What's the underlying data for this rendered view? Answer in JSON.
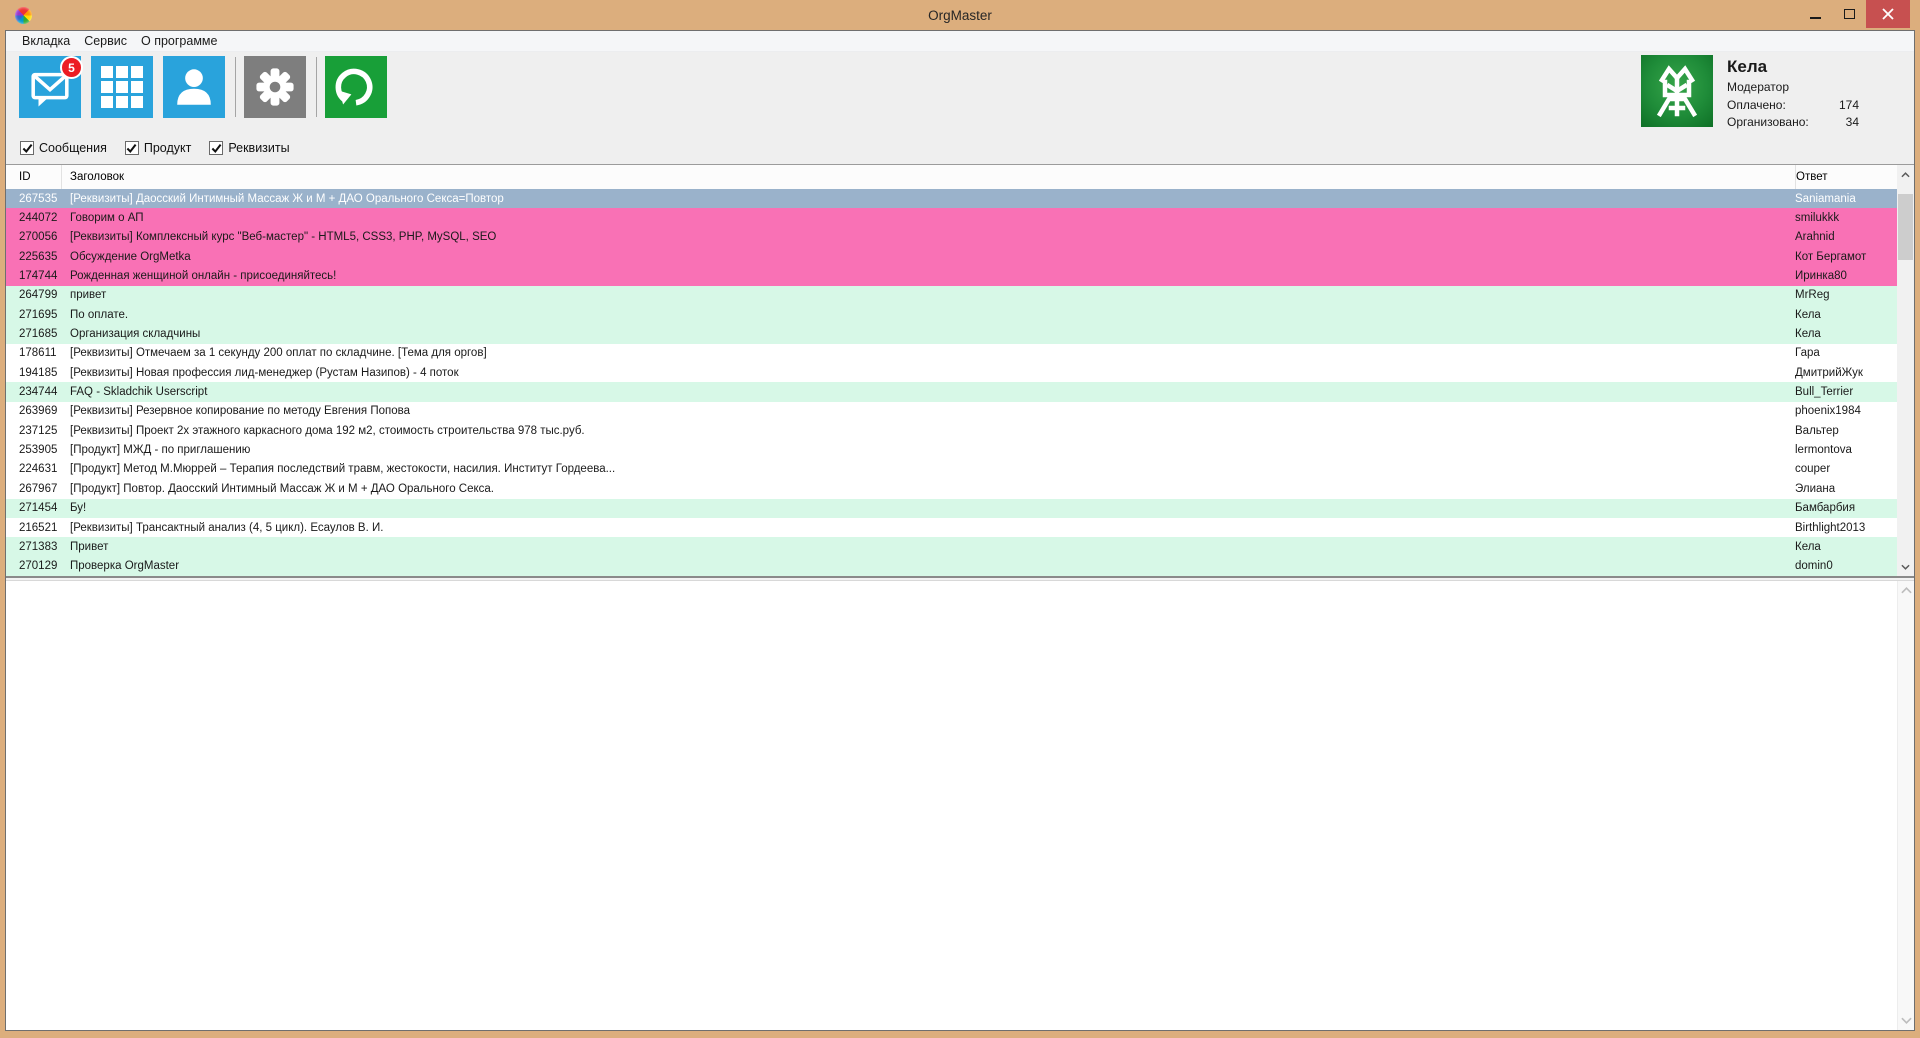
{
  "window": {
    "title": "OrgMaster"
  },
  "menu": {
    "items": [
      "Вкладка",
      "Сервис",
      "О программе"
    ]
  },
  "toolbar": {
    "badge": "5",
    "icons": [
      "mail-icon",
      "grid-icon",
      "user-icon",
      "gear-icon",
      "refresh-icon"
    ]
  },
  "user_panel": {
    "name": "Кела",
    "role": "Модератор",
    "paid_label": "Оплачено:",
    "paid_value": "174",
    "organized_label": "Организовано:",
    "organized_value": "34"
  },
  "filters": [
    {
      "label": "Сообщения",
      "checked": true
    },
    {
      "label": "Продукт",
      "checked": true
    },
    {
      "label": "Реквизиты",
      "checked": true
    }
  ],
  "table": {
    "columns": [
      "ID",
      "Заголовок",
      "Ответ"
    ],
    "rows": [
      {
        "id": "267535",
        "title": "[Реквизиты] Даосский Интимный Массаж Ж и М + ДАО Орального Секса=Повтор",
        "answer": "Saniamania",
        "state": "selected"
      },
      {
        "id": "244072",
        "title": "Говорим о АП",
        "answer": "smilukkk",
        "state": "pink"
      },
      {
        "id": "270056",
        "title": "[Реквизиты] Комплексный курс \"Веб-мастер\" - HTML5, CSS3, PHP, MySQL, SEO",
        "answer": "Arahnid",
        "state": "pink"
      },
      {
        "id": "225635",
        "title": "Обсуждение OrgMetka",
        "answer": "Кот Бергамот",
        "state": "pink"
      },
      {
        "id": "174744",
        "title": "Рожденная женщиной онлайн - присоединяйтесь!",
        "answer": "Иринка80",
        "state": "pink"
      },
      {
        "id": "264799",
        "title": "привет",
        "answer": "MrReg",
        "state": "green"
      },
      {
        "id": "271695",
        "title": "По оплате.",
        "answer": "Кела",
        "state": "green"
      },
      {
        "id": "271685",
        "title": "Организация складчины",
        "answer": "Кела",
        "state": "green"
      },
      {
        "id": "178611",
        "title": "[Реквизиты] Отмечаем за 1 секунду 200 оплат по складчине. [Тема для оргов]",
        "answer": "Гара",
        "state": "white"
      },
      {
        "id": "194185",
        "title": "[Реквизиты] Новая профессия лид-менеджер (Рустам Назипов) - 4 поток",
        "answer": "ДмитрийЖук",
        "state": "white"
      },
      {
        "id": "234744",
        "title": "FAQ - Skladchik Userscript",
        "answer": "Bull_Terrier",
        "state": "green"
      },
      {
        "id": "263969",
        "title": "[Реквизиты] Резервное копирование по методу Евгения Попова",
        "answer": "phoenix1984",
        "state": "white"
      },
      {
        "id": "237125",
        "title": "[Реквизиты] Проект 2х этажного каркасного дома 192 м2, стоимость строительства 978 тыс.руб.",
        "answer": "Вальтер",
        "state": "white"
      },
      {
        "id": "253905",
        "title": "[Продукт] МЖД - по приглашению",
        "answer": "lermontova",
        "state": "white"
      },
      {
        "id": "224631",
        "title": "[Продукт] Метод М.Мюррей – Терапия  последствий травм, жестокости, насилия. Институт Гордеева...",
        "answer": "couper",
        "state": "white"
      },
      {
        "id": "267967",
        "title": "[Продукт] Повтор. Даосский Интимный Массаж Ж и М + ДАО Орального Секса.",
        "answer": "Элиана",
        "state": "white"
      },
      {
        "id": "271454",
        "title": "Бу!",
        "answer": "Бамбарбия",
        "state": "green"
      },
      {
        "id": "216521",
        "title": "[Реквизиты] Трансактный анализ (4, 5 цикл). Есаулов В. И.",
        "answer": "Birthlight2013",
        "state": "white"
      },
      {
        "id": "271383",
        "title": "Привет",
        "answer": "Кела",
        "state": "green"
      },
      {
        "id": "270129",
        "title": "Проверка OrgMaster",
        "answer": "domin0",
        "state": "green"
      }
    ]
  },
  "colors": {
    "titlebar": "#DCAE7D",
    "close_button": "#C75050",
    "accent_blue": "#29A3DC",
    "button_gray": "#7E7E7E",
    "button_green": "#189F38",
    "badge_red": "#EC1C23",
    "row_pink": "#F971B5",
    "row_green": "#D7F8E7",
    "row_selected": "#9AB2CB"
  }
}
